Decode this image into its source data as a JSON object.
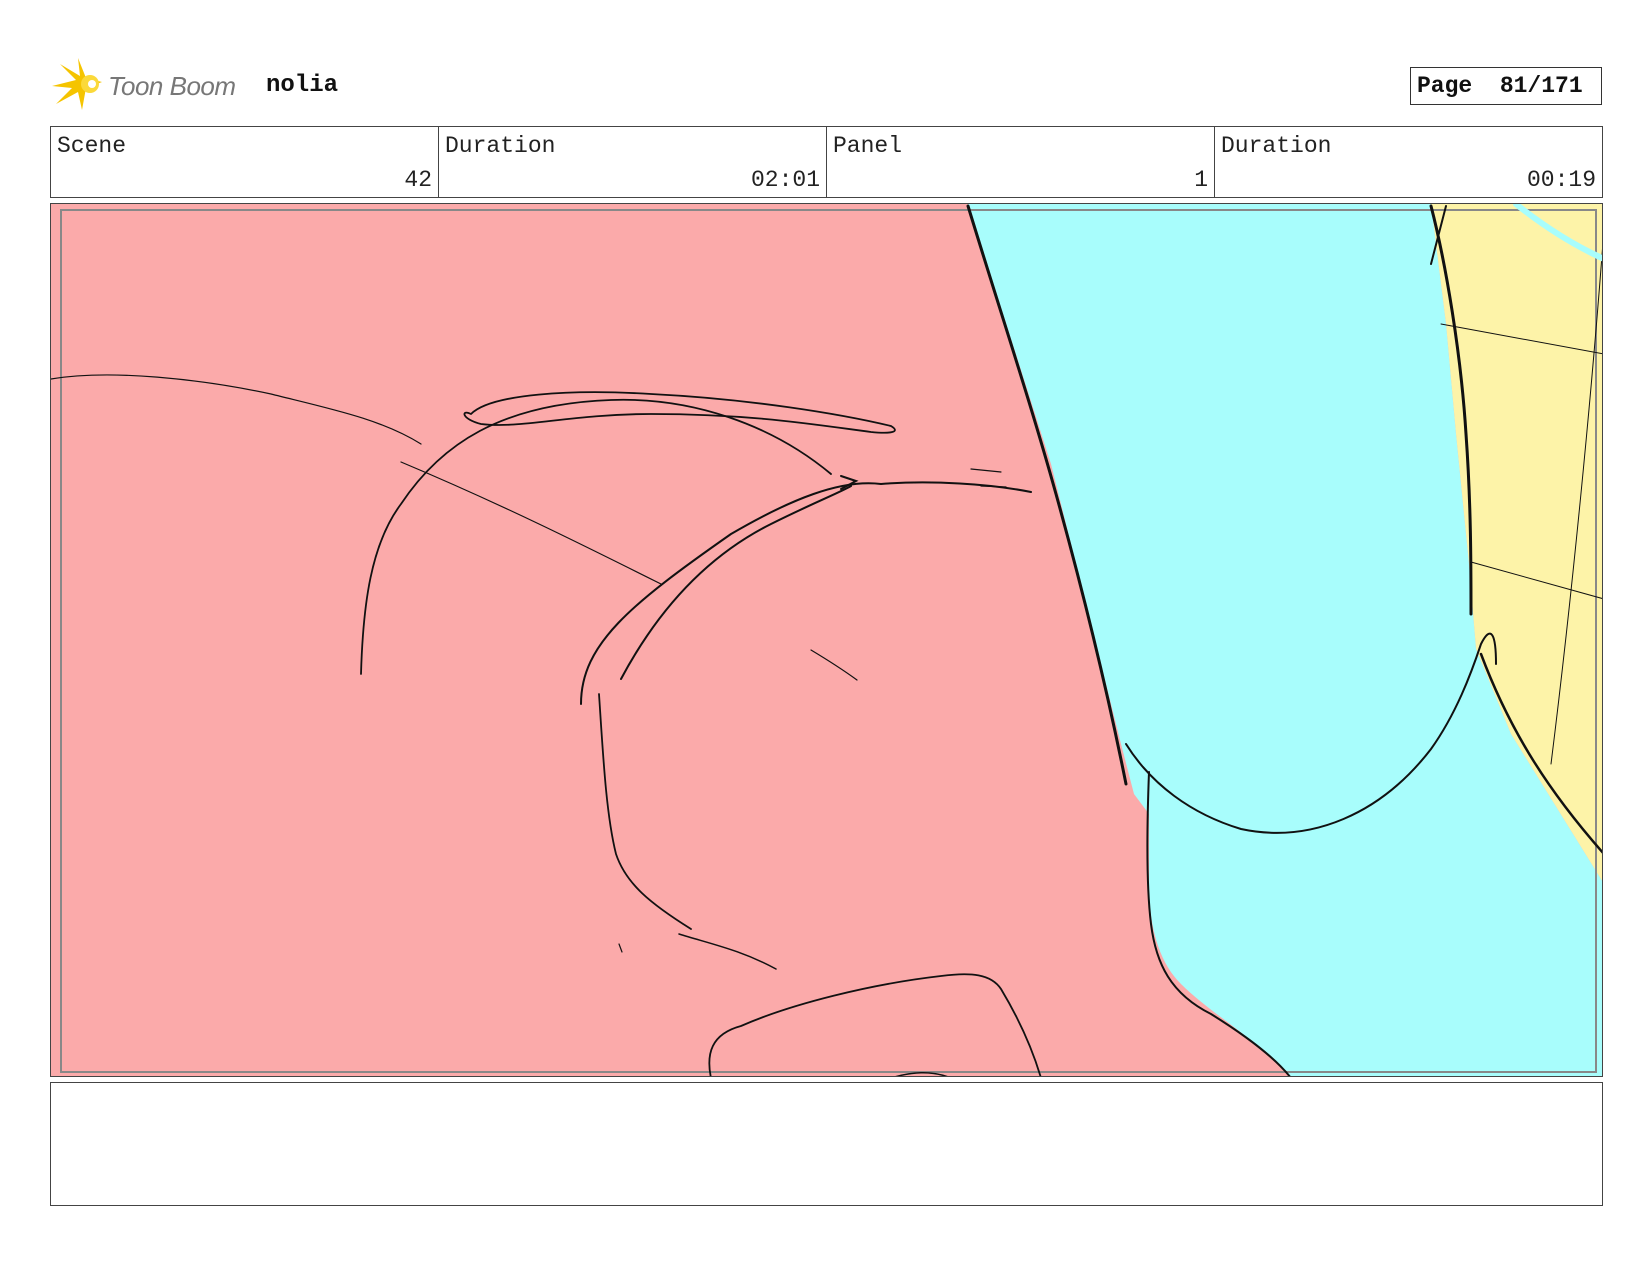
{
  "header": {
    "logo_text": "Toon Boom",
    "project_name": "nolia",
    "page_label": "Page",
    "page_number": "81/171"
  },
  "info": {
    "scene_label": "Scene",
    "scene_value": "42",
    "scene_duration_label": "Duration",
    "scene_duration_value": "02:01",
    "panel_label": "Panel",
    "panel_value": "1",
    "panel_duration_label": "Duration",
    "panel_duration_value": "00:19"
  },
  "colors": {
    "pink": "#fbaaaa",
    "cyan": "#a8fdfc",
    "yellow": "#fdf3a8",
    "logo_yellow": "#f5c400"
  },
  "notes": {
    "text": ""
  }
}
